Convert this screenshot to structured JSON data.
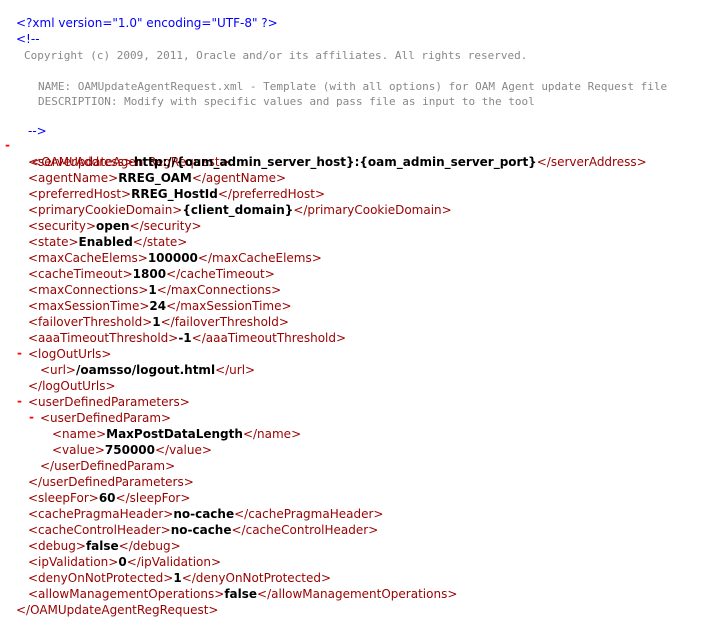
{
  "xml": {
    "declaration": "<?xml version=\"1.0\" encoding=\"UTF-8\" ?>",
    "comment_open": "<!--",
    "comment_close": "-->",
    "toggle_symbol": "-",
    "comment_lines": [
      "Copyright (c) 2009, 2011, Oracle and/or its affiliates. All rights reserved.",
      "NAME: OAMUpdateAgentRequest.xml - Template (with all options) for OAM Agent update Request file",
      "DESCRIPTION: Modify with specific values and pass file as input to the tool"
    ],
    "root": {
      "open": "<OAMUpdateAgentRegRequest>",
      "close": "</OAMUpdateAgentRegRequest>"
    },
    "fields": {
      "serverAddress": {
        "open": "<serverAddress>",
        "value": "http://{oam_admin_server_host}:{oam_admin_server_port}",
        "close": "</serverAddress>"
      },
      "agentName": {
        "open": "<agentName>",
        "value": "RREG_OAM",
        "close": "</agentName>"
      },
      "preferredHost": {
        "open": "<preferredHost>",
        "value": "RREG_HostId",
        "close": "</preferredHost>"
      },
      "primaryCookieDomain": {
        "open": "<primaryCookieDomain>",
        "value": "{client_domain}",
        "close": "</primaryCookieDomain>"
      },
      "security": {
        "open": "<security>",
        "value": "open",
        "close": "</security>"
      },
      "state": {
        "open": "<state>",
        "value": "Enabled",
        "close": "</state>"
      },
      "maxCacheElems": {
        "open": "<maxCacheElems>",
        "value": "100000",
        "close": "</maxCacheElems>"
      },
      "cacheTimeout": {
        "open": "<cacheTimeout>",
        "value": "1800",
        "close": "</cacheTimeout>"
      },
      "maxConnections": {
        "open": "<maxConnections>",
        "value": "1",
        "close": "</maxConnections>"
      },
      "maxSessionTime": {
        "open": "<maxSessionTime>",
        "value": "24",
        "close": "</maxSessionTime>"
      },
      "failoverThreshold": {
        "open": "<failoverThreshold>",
        "value": "1",
        "close": "</failoverThreshold>"
      },
      "aaaTimeoutThreshold": {
        "open": "<aaaTimeoutThreshold>",
        "value": "-1",
        "close": "</aaaTimeoutThreshold>"
      },
      "logOutUrls": {
        "open": "<logOutUrls>",
        "close": "</logOutUrls>"
      },
      "url": {
        "open": "<url>",
        "value": "/oamsso/logout.html",
        "close": "</url>"
      },
      "userDefinedParameters": {
        "open": "<userDefinedParameters>",
        "close": "</userDefinedParameters>"
      },
      "userDefinedParam": {
        "open": "<userDefinedParam>",
        "close": "</userDefinedParam>"
      },
      "name": {
        "open": "<name>",
        "value": "MaxPostDataLength",
        "close": "</name>"
      },
      "value": {
        "open": "<value>",
        "value": "750000",
        "close": "</value>"
      },
      "sleepFor": {
        "open": "<sleepFor>",
        "value": "60",
        "close": "</sleepFor>"
      },
      "cachePragmaHeader": {
        "open": "<cachePragmaHeader>",
        "value": "no-cache",
        "close": "</cachePragmaHeader>"
      },
      "cacheControlHeader": {
        "open": "<cacheControlHeader>",
        "value": "no-cache",
        "close": "</cacheControlHeader>"
      },
      "debug": {
        "open": "<debug>",
        "value": "false",
        "close": "</debug>"
      },
      "ipValidation": {
        "open": "<ipValidation>",
        "value": "0",
        "close": "</ipValidation>"
      },
      "denyOnNotProtected": {
        "open": "<denyOnNotProtected>",
        "value": "1",
        "close": "</denyOnNotProtected>"
      },
      "allowManagementOperations": {
        "open": "<allowManagementOperations>",
        "value": "false",
        "close": "</allowManagementOperations>"
      }
    }
  },
  "colors": {
    "tag": "#990000",
    "declaration": "#0000ff",
    "comment_text": "#888888",
    "value": "#000000",
    "toggle": "#ff0000"
  }
}
